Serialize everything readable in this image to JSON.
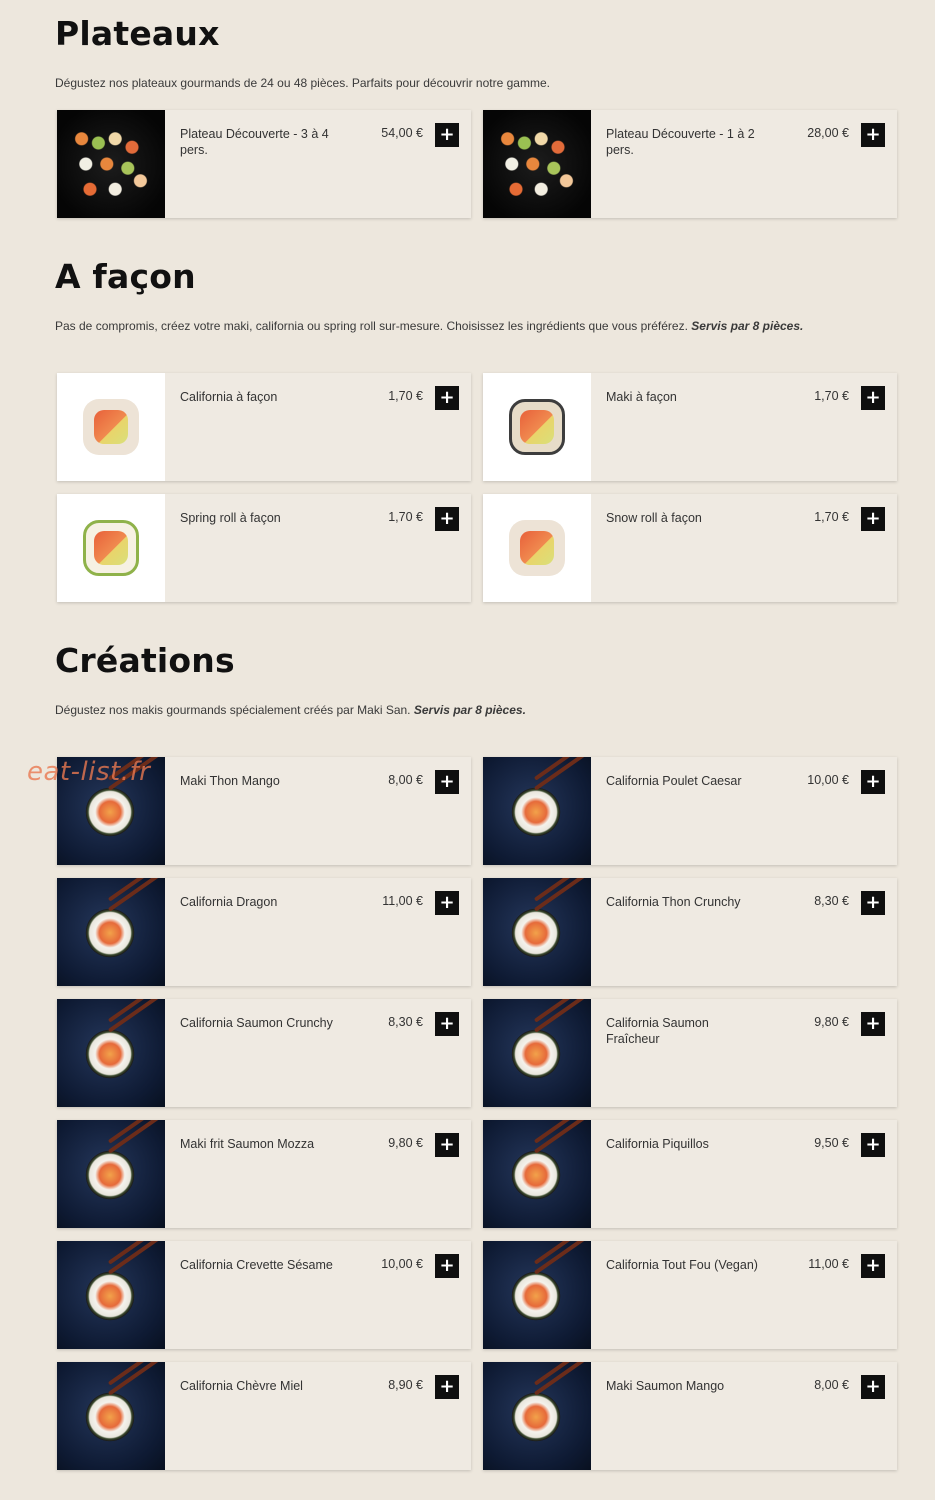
{
  "watermark": "eat-list.fr",
  "colors": {
    "background": "#ede7dd",
    "card": "#efeae2",
    "add_button": "#0f0f0f"
  },
  "sections": {
    "plateaux": {
      "title": "Plateaux",
      "desc": "Dégustez nos plateaux gourmands de 24 ou 48 pièces. Parfaits pour découvrir notre gamme.",
      "items": [
        {
          "name": "Plateau Découverte - 3 à 4 pers.",
          "price": "54,00 €",
          "add": "+"
        },
        {
          "name": "Plateau Découverte - 1 à 2 pers.",
          "price": "28,00 €",
          "add": "+"
        }
      ]
    },
    "facon": {
      "title": "A façon",
      "desc": "Pas de compromis, créez votre maki, california ou spring roll sur-mesure. Choisissez les ingrédients que vous préférez.",
      "desc_em": "Servis par 8 pièces.",
      "items": [
        {
          "name": "California à façon",
          "price": "1,70 €",
          "add": "+"
        },
        {
          "name": "Maki à façon",
          "price": "1,70 €",
          "add": "+"
        },
        {
          "name": "Spring roll à façon",
          "price": "1,70 €",
          "add": "+"
        },
        {
          "name": "Snow roll à façon",
          "price": "1,70 €",
          "add": "+"
        }
      ]
    },
    "creations": {
      "title": "Créations",
      "desc": "Dégustez nos makis gourmands spécialement créés par Maki San.",
      "desc_em": "Servis par 8 pièces.",
      "items": [
        {
          "name": "Maki Thon Mango",
          "price": "8,00 €",
          "add": "+"
        },
        {
          "name": "California Poulet Caesar",
          "price": "10,00 €",
          "add": "+"
        },
        {
          "name": "California Dragon",
          "price": "11,00 €",
          "add": "+"
        },
        {
          "name": "California Thon Crunchy",
          "price": "8,30 €",
          "add": "+"
        },
        {
          "name": "California Saumon Crunchy",
          "price": "8,30 €",
          "add": "+"
        },
        {
          "name": "California Saumon Fraîcheur",
          "price": "9,80 €",
          "add": "+"
        },
        {
          "name": "Maki frit Saumon Mozza",
          "price": "9,80 €",
          "add": "+"
        },
        {
          "name": "California Piquillos",
          "price": "9,50 €",
          "add": "+"
        },
        {
          "name": "California Crevette Sésame",
          "price": "10,00 €",
          "add": "+"
        },
        {
          "name": "California Tout Fou (Vegan)",
          "price": "11,00 €",
          "add": "+"
        },
        {
          "name": "California Chèvre Miel",
          "price": "8,90 €",
          "add": "+"
        },
        {
          "name": "Maki Saumon Mango",
          "price": "8,00 €",
          "add": "+"
        }
      ]
    }
  }
}
